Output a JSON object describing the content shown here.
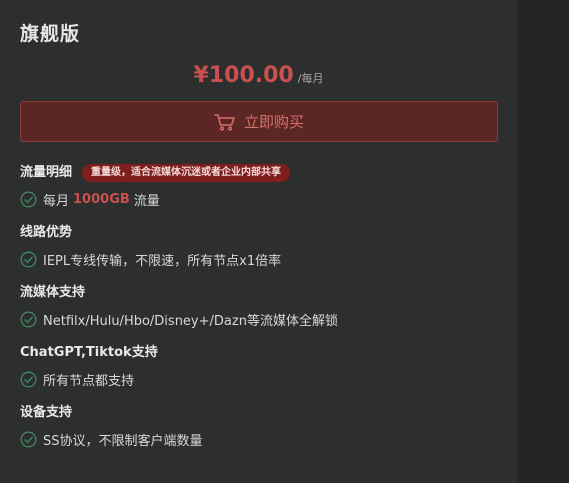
{
  "plan": {
    "title": "旗舰版",
    "price": "¥100.00",
    "period": "/每月",
    "buy_label": "立即购买"
  },
  "colors": {
    "accent": "#c8514f",
    "button_bg": "#5b2624",
    "check": "#3e8a62",
    "badge_bg": "#7e1f1d"
  },
  "sections": [
    {
      "title": "流量明细",
      "badge": "重量级，适合流媒体沉迷或者企业内部共享",
      "feature_prefix": "每月",
      "feature_highlight": "1000GB",
      "feature_suffix": "流量"
    },
    {
      "title": "线路优势",
      "feature": "IEPL专线传输，不限速，所有节点x1倍率"
    },
    {
      "title": "流媒体支持",
      "feature": "Netfilx/Hulu/Hbo/Disney+/Dazn等流媒体全解锁"
    },
    {
      "title": "ChatGPT,Tiktok支持",
      "feature": "所有节点都支持"
    },
    {
      "title": "设备支持",
      "feature": "SS协议，不限制客户端数量"
    }
  ],
  "icons": {
    "cart": "cart-icon",
    "check": "check-circle-icon"
  }
}
